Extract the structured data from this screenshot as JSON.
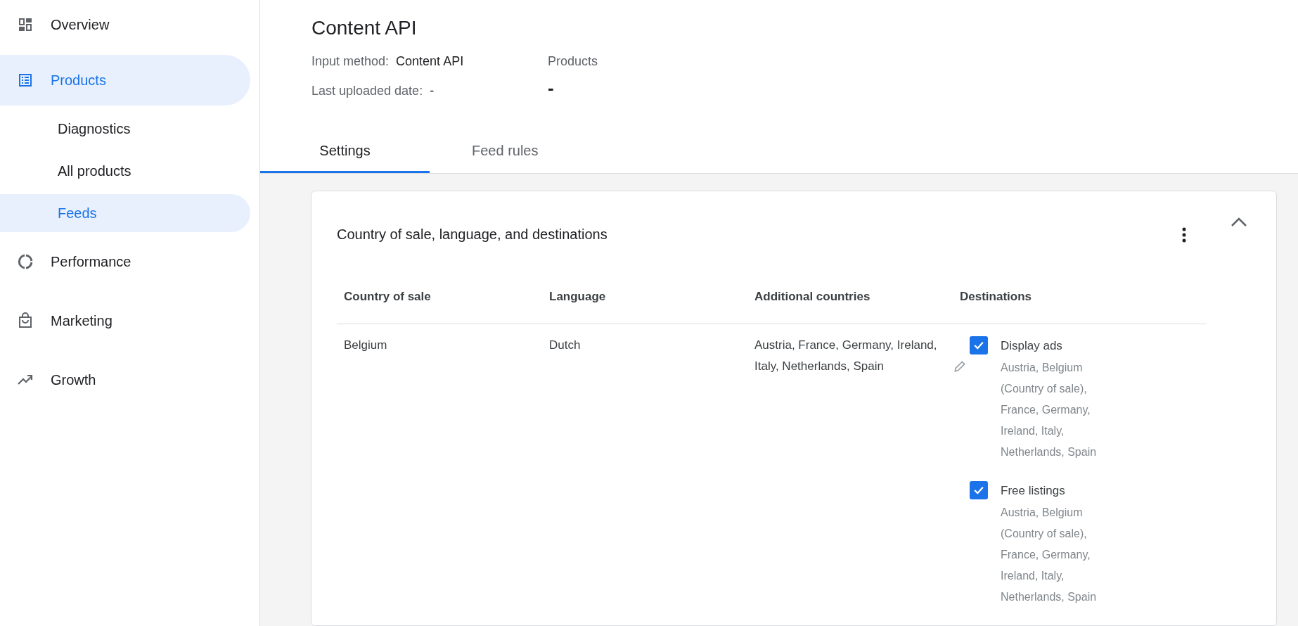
{
  "sidebar": {
    "items": [
      {
        "label": "Overview",
        "kind": "dashboard",
        "selected": false
      },
      {
        "label": "Products",
        "kind": "list",
        "selected": true,
        "children": [
          {
            "label": "Diagnostics",
            "selected": false
          },
          {
            "label": "All products",
            "selected": false
          },
          {
            "label": "Feeds",
            "selected": true
          }
        ]
      },
      {
        "label": "Performance",
        "kind": "ring",
        "selected": false
      },
      {
        "label": "Marketing",
        "kind": "bag",
        "selected": false
      },
      {
        "label": "Growth",
        "kind": "trend",
        "selected": false
      }
    ]
  },
  "header": {
    "title": "Content API",
    "fields": [
      {
        "label": "Input method:",
        "value": "Content API"
      },
      {
        "label": "Last uploaded date:",
        "value": "-"
      }
    ],
    "products": {
      "label": "Products",
      "value": "-"
    }
  },
  "tabs": [
    {
      "label": "Settings",
      "selected": true
    },
    {
      "label": "Feed rules",
      "selected": false
    }
  ],
  "card": {
    "title": "Country of sale, language, and destinations",
    "expanded": true,
    "table": {
      "columns": [
        "Country of sale",
        "Language",
        "Additional countries",
        "Destinations"
      ],
      "rows": [
        {
          "country": "Belgium",
          "language": "Dutch",
          "additional_countries": "Austria, France, Germany, Ireland, Italy, Netherlands, Spain",
          "destinations": [
            {
              "label": "Display ads",
              "checked": true,
              "countries": "Austria, Belgium (Country of sale), France, Germany, Ireland, Italy, Netherlands, Spain"
            },
            {
              "label": "Free listings",
              "checked": true,
              "countries": "Austria, Belgium (Country of sale), France, Germany, Ireland, Italy, Netherlands, Spain"
            }
          ]
        }
      ]
    }
  }
}
